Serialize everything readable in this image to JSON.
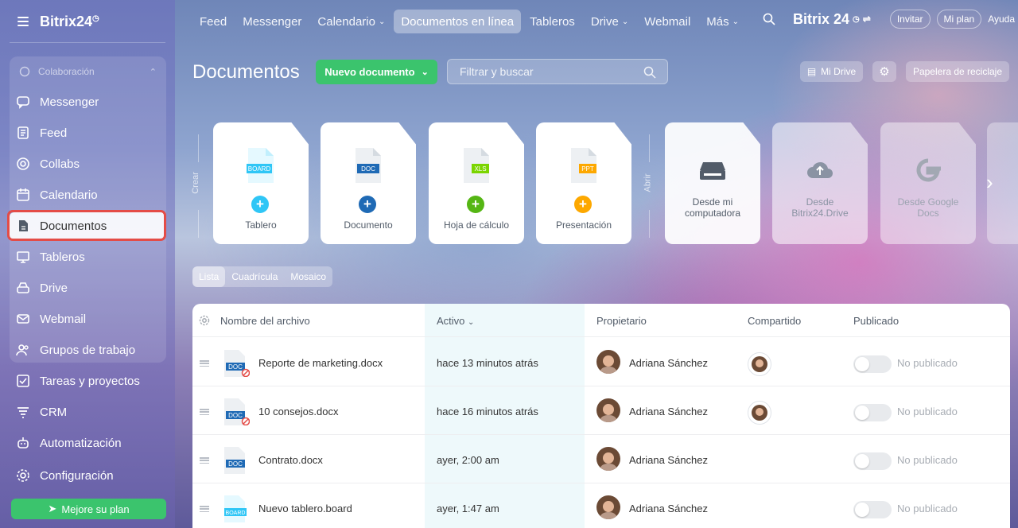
{
  "sidebar": {
    "logo": "Bitrix24",
    "group_label": "Colaboración",
    "items": [
      {
        "label": "Messenger"
      },
      {
        "label": "Feed"
      },
      {
        "label": "Collabs"
      },
      {
        "label": "Calendario"
      },
      {
        "label": "Documentos"
      },
      {
        "label": "Tableros"
      },
      {
        "label": "Drive"
      },
      {
        "label": "Webmail"
      },
      {
        "label": "Grupos de trabajo"
      },
      {
        "label": "Tareas y proyectos"
      },
      {
        "label": "CRM"
      },
      {
        "label": "Automatización"
      },
      {
        "label": "Configuración"
      }
    ],
    "upgrade_label": "Mejore su plan"
  },
  "topnav": {
    "items": [
      {
        "label": "Feed"
      },
      {
        "label": "Messenger"
      },
      {
        "label": "Calendario"
      },
      {
        "label": "Documentos en línea"
      },
      {
        "label": "Tableros"
      },
      {
        "label": "Drive"
      },
      {
        "label": "Webmail"
      },
      {
        "label": "Más"
      }
    ],
    "brand": "Bitrix 24",
    "invite": "Invitar",
    "my_plan": "Mi plan",
    "help": "Ayuda"
  },
  "header": {
    "title": "Documentos",
    "new_doc": "Nuevo documento",
    "filter_placeholder": "Filtrar y buscar",
    "my_drive": "Mi Drive",
    "recycle": "Papelera de reciclaje"
  },
  "create": {
    "label": "Crear",
    "cards": [
      {
        "label": "Tablero",
        "tag": "BOARD",
        "color": "#2fc6f6"
      },
      {
        "label": "Documento",
        "tag": "DOC",
        "color": "#1f6ab5"
      },
      {
        "label": "Hoja de cálculo",
        "tag": "XLS",
        "color": "#7bd500"
      },
      {
        "label": "Presentación",
        "tag": "PPT",
        "color": "#fda800"
      }
    ]
  },
  "open": {
    "label": "Abrir",
    "cards": [
      {
        "label": "Desde mi computadora"
      },
      {
        "label": "Desde Bitrix24.Drive"
      },
      {
        "label": "Desde Google Docs"
      }
    ]
  },
  "view_tabs": {
    "list": "Lista",
    "grid": "Cuadrícula",
    "mosaic": "Mosaico"
  },
  "table": {
    "headers": {
      "name": "Nombre del archivo",
      "active": "Activo",
      "owner": "Propietario",
      "shared": "Compartido",
      "published": "Publicado"
    },
    "rows": [
      {
        "name": "Reporte de marketing.docx",
        "tag": "DOC",
        "active": "hace 13 minutos atrás",
        "owner": "Adriana Sánchez",
        "published": "No publicado"
      },
      {
        "name": "10 consejos.docx",
        "tag": "DOC",
        "active": "hace 16 minutos atrás",
        "owner": "Adriana Sánchez",
        "published": "No publicado"
      },
      {
        "name": "Contrato.docx",
        "tag": "DOC",
        "active": "ayer, 2:00 am",
        "owner": "Adriana Sánchez",
        "published": "No publicado"
      },
      {
        "name": "Nuevo tablero.board",
        "tag": "BOARD",
        "active": "ayer, 1:47 am",
        "owner": "Adriana Sánchez",
        "published": "No publicado"
      }
    ]
  }
}
